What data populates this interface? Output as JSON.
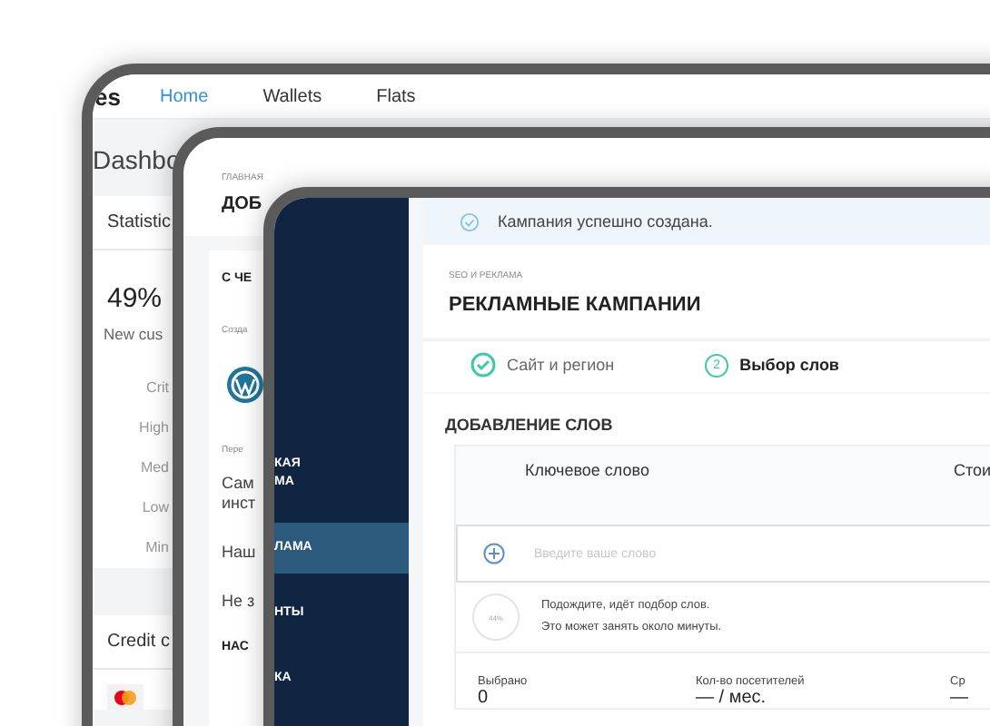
{
  "dashboard_window": {
    "brand": "es",
    "nav": [
      {
        "label": "Home",
        "selected": true
      },
      {
        "label": "Wallets",
        "selected": false
      },
      {
        "label": "Flats",
        "selected": false
      }
    ],
    "heading": "Dashbo",
    "card_title": "Statistic",
    "percent": "49%",
    "percent_label": "New cus",
    "levels": [
      "Crit",
      "High",
      "Med",
      "Low",
      "Min"
    ],
    "credit_title": "Credit c"
  },
  "sites_window": {
    "breadcrumb": "ГЛАВНАЯ",
    "title": "ДОБ",
    "section": "С ЧЕ",
    "caption": "Созда",
    "caption_2": "Пере",
    "items": [
      "Сам\nинст",
      "Наш",
      "Не з"
    ],
    "footer": "НАС"
  },
  "campaign_window": {
    "sidebar": [
      {
        "label": "КАЯ\nМА",
        "selected": false
      },
      {
        "label": "ЛАМА",
        "selected": true
      },
      {
        "label": "НТЫ",
        "selected": false
      },
      {
        "label": "КА",
        "selected": false
      }
    ],
    "alert": "Кампания успешно создана.",
    "breadcrumb": "SEO И РЕКЛАМА",
    "title": "РЕКЛАМНЫЕ КАМПАНИИ",
    "steps": [
      {
        "label": "Сайт и регион",
        "done": true
      },
      {
        "number": "2",
        "label": "Выбор слов",
        "done": false
      }
    ],
    "section": "ДОБАВЛЕНИЕ СЛОВ",
    "columns": [
      "Ключевое слово",
      "Стои"
    ],
    "input": {
      "placeholder": "Введите ваше слово"
    },
    "progress": {
      "reading": "44%",
      "lines": [
        "Подождите, идёт подбор слов.",
        "Это может занять около минуты."
      ]
    },
    "stats": [
      {
        "label": "Выбрано",
        "value": "0"
      },
      {
        "label": "Кол-во посетителей",
        "value": "— / мес."
      },
      {
        "label": "Ср",
        "value": "—"
      }
    ]
  }
}
